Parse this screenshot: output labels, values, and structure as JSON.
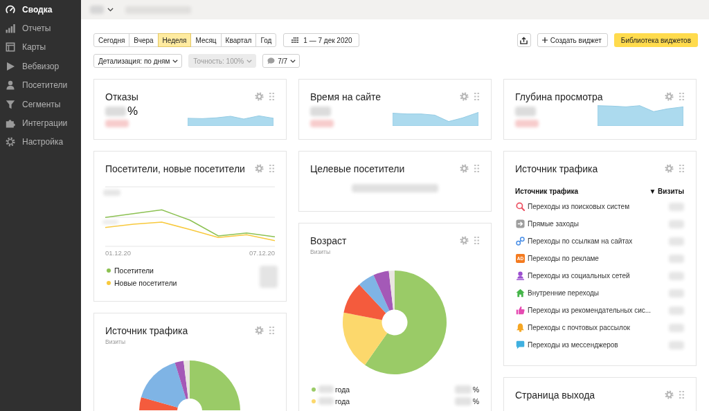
{
  "sidebar": {
    "items": [
      {
        "label": "Сводка",
        "selected": true
      },
      {
        "label": "Отчеты",
        "selected": false
      },
      {
        "label": "Карты",
        "selected": false
      },
      {
        "label": "Вебвизор",
        "selected": false
      },
      {
        "label": "Посетители",
        "selected": false
      },
      {
        "label": "Сегменты",
        "selected": false
      },
      {
        "label": "Интеграции",
        "selected": false
      },
      {
        "label": "Настройка",
        "selected": false
      }
    ]
  },
  "toolbar": {
    "periods": [
      {
        "label": "Сегодня",
        "selected": false
      },
      {
        "label": "Вчера",
        "selected": false
      },
      {
        "label": "Неделя",
        "selected": true
      },
      {
        "label": "Месяц",
        "selected": false
      },
      {
        "label": "Квартал",
        "selected": false
      },
      {
        "label": "Год",
        "selected": false
      }
    ],
    "date_range": "1 — 7 дек 2020",
    "create_widget": "Создать виджет",
    "widget_library": "Библиотека виджетов",
    "filters": [
      {
        "kind": "select",
        "label": "Детализация: по дням",
        "disabled": false
      },
      {
        "kind": "select",
        "label": "Точность: 100%",
        "disabled": true
      },
      {
        "kind": "comments",
        "label": "7/7",
        "disabled": false
      }
    ]
  },
  "dashboard": {
    "columns": [
      {
        "widgets": [
          {
            "kind": "metric",
            "title": "Отказы",
            "unit": "%"
          },
          {
            "kind": "line",
            "title": "Посетители, новые посетители",
            "x_start": "01.12.20",
            "x_end": "07.12.20",
            "legend": [
              {
                "label": "Посетители",
                "color": "#8cc152"
              },
              {
                "label": "Новые посетители",
                "color": "#f8c93c"
              }
            ]
          },
          {
            "kind": "pie",
            "title": "Источник трафика",
            "subtitle": "Визиты"
          }
        ]
      },
      {
        "widgets": [
          {
            "kind": "metric",
            "title": "Время на сайте"
          },
          {
            "kind": "value",
            "title": "Целевые посетители"
          },
          {
            "kind": "pie",
            "title": "Возраст",
            "subtitle": "Визиты",
            "legend": [
              {
                "label": "года",
                "unit": "%",
                "color": "#9acb67"
              },
              {
                "label": "года",
                "unit": "%",
                "color": "#fcd86c"
              }
            ]
          }
        ]
      },
      {
        "widgets": [
          {
            "kind": "metric",
            "title": "Глубина просмотра"
          },
          {
            "kind": "table",
            "title": "Источник трафика",
            "header": [
              "Источник трафика",
              "▼ Визиты"
            ],
            "rows": [
              {
                "label": "Переходы из поисковых систем"
              },
              {
                "label": "Прямые заходы"
              },
              {
                "label": "Переходы по ссылкам на сайтах"
              },
              {
                "label": "Переходы по рекламе",
                "badge": "AD"
              },
              {
                "label": "Переходы из социальных сетей"
              },
              {
                "label": "Внутренние переходы"
              },
              {
                "label": "Переходы из рекомендательных сис..."
              },
              {
                "label": "Переходы с почтовых рассылок"
              },
              {
                "label": "Переходы из мессенджеров"
              }
            ]
          },
          {
            "kind": "table",
            "title": "Страница выхода"
          }
        ]
      }
    ]
  }
}
